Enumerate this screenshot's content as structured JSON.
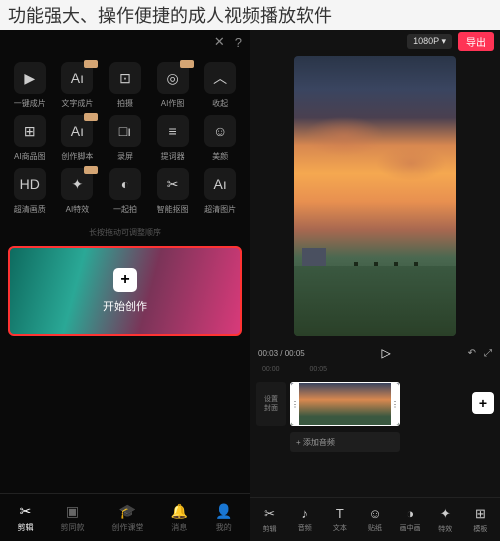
{
  "header": {
    "title": "功能强大、操作便捷的成人视频播放软件"
  },
  "left": {
    "tools": {
      "row1": [
        {
          "icon": "▶",
          "label": "一键成片",
          "badge": false
        },
        {
          "icon": "Aı",
          "label": "文字成片",
          "badge": true
        },
        {
          "icon": "⊡",
          "label": "拍摄",
          "badge": false
        },
        {
          "icon": "◎",
          "label": "AI作图",
          "badge": true
        },
        {
          "icon": "︿",
          "label": "收起",
          "badge": false
        }
      ],
      "row2": [
        {
          "icon": "⊞",
          "label": "AI商品图",
          "badge": false
        },
        {
          "icon": "Aı",
          "label": "创作脚本",
          "badge": true
        },
        {
          "icon": "□ı",
          "label": "录屏",
          "badge": false
        },
        {
          "icon": "≡",
          "label": "提词器",
          "badge": false
        },
        {
          "icon": "☺",
          "label": "美颜",
          "badge": false
        }
      ],
      "row3": [
        {
          "icon": "HD",
          "label": "超清画质",
          "badge": false
        },
        {
          "icon": "✦",
          "label": "AI特效",
          "badge": true
        },
        {
          "icon": "◐",
          "label": "一起拍",
          "badge": false
        },
        {
          "icon": "✂",
          "label": "智能抠图",
          "badge": false
        },
        {
          "icon": "Aı",
          "label": "超清图片",
          "badge": false
        }
      ]
    },
    "drag_hint": "长按拖动可调整顺序",
    "create": {
      "plus": "+",
      "label": "开始创作"
    },
    "nav": [
      {
        "icon": "✂",
        "label": "剪辑",
        "active": true
      },
      {
        "icon": "▣",
        "label": "剪同款",
        "active": false
      },
      {
        "icon": "🎓",
        "label": "创作课堂",
        "active": false
      },
      {
        "icon": "🔔",
        "label": "消息",
        "active": false
      },
      {
        "icon": "👤",
        "label": "我的",
        "active": false
      }
    ]
  },
  "right": {
    "titlebar": {
      "close": "✕",
      "help": "?"
    },
    "top": {
      "resolution": "1080P ▾",
      "export": "导出"
    },
    "playbar": {
      "time_current": "00:03",
      "time_sep": " / ",
      "time_total": "00:05",
      "play": "▷",
      "undo": "↶",
      "expand": "⤢"
    },
    "ruler": [
      "00:00",
      "00:05"
    ],
    "timeline": {
      "cover_label_l1": "设置",
      "cover_label_l2": "封面",
      "add_clip": "+",
      "audio_label": "+ 添加音频"
    },
    "bottom": [
      {
        "icon": "✂",
        "label": "剪辑"
      },
      {
        "icon": "♪",
        "label": "音频"
      },
      {
        "icon": "T",
        "label": "文本"
      },
      {
        "icon": "☺",
        "label": "贴纸"
      },
      {
        "icon": "◑",
        "label": "画中画"
      },
      {
        "icon": "✦",
        "label": "特效"
      },
      {
        "icon": "⊞",
        "label": "模板"
      }
    ]
  }
}
